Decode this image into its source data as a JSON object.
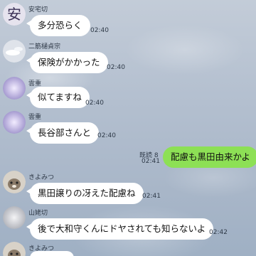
{
  "messages": [
    {
      "sender": "安宅切",
      "text": "多分恐らく",
      "time": "02:40",
      "avatar_icon": "kanji-avatar-icon"
    },
    {
      "sender": "二筋樋貞宗",
      "text": "保険がかかった",
      "time": "02:40",
      "avatar_icon": "snow-avatar-icon"
    },
    {
      "sender": "雲重",
      "text": "似てますね",
      "time": "02:40",
      "avatar_icon": "purple-blur-avatar-icon"
    },
    {
      "sender": "雲重",
      "text": "長谷部さんと",
      "time": "02:40",
      "avatar_icon": "purple-blur-avatar-icon"
    },
    {
      "sender": "",
      "text": "配慮も黒田由来かよ",
      "time": "02:41",
      "read": "既読 8",
      "outgoing": true
    },
    {
      "sender": "きよみつ",
      "text": "黒田譲りの冴えた配慮ね",
      "time": "02:41",
      "avatar_icon": "dog-avatar-icon"
    },
    {
      "sender": "山姥切",
      "text": "後で大和守くんにドヤされても知らないよ",
      "time": "02:42",
      "avatar_icon": "grey-blur-avatar-icon"
    },
    {
      "sender": "きよみつ",
      "text": "",
      "time": "",
      "avatar_icon": "dog-avatar-icon"
    }
  ],
  "colors": {
    "outgoing_bubble": "#8de055",
    "incoming_bubble": "#ffffff",
    "background": "#b3bfcf"
  }
}
